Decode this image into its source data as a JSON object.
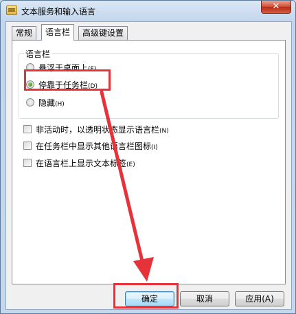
{
  "window": {
    "title": "文本服务和输入语言",
    "close_symbol": "✕"
  },
  "tabs": [
    {
      "label": "常规",
      "active": false
    },
    {
      "label": "语言栏",
      "active": true
    },
    {
      "label": "高级键设置",
      "active": false
    }
  ],
  "language_bar_group": {
    "label": "语言栏",
    "options": [
      {
        "label": "悬浮于桌面上",
        "hotkey": "(F)",
        "checked": false
      },
      {
        "label": "停靠于任务栏",
        "hotkey": "(D)",
        "checked": true
      },
      {
        "label": "隐藏",
        "hotkey": "(H)",
        "checked": false
      }
    ]
  },
  "checkboxes": [
    {
      "label": "非活动时，以透明状态显示语言栏",
      "hotkey": "(N)",
      "checked": false
    },
    {
      "label": "在任务栏中显示其他语言栏图标",
      "hotkey": "(I)",
      "checked": false
    },
    {
      "label": "在语言栏上显示文本标签",
      "hotkey": "(E)",
      "checked": false
    }
  ],
  "buttons": {
    "ok": "确定",
    "cancel": "取消",
    "apply": "应用(A)"
  },
  "colors": {
    "annotation": "#e8323a"
  }
}
